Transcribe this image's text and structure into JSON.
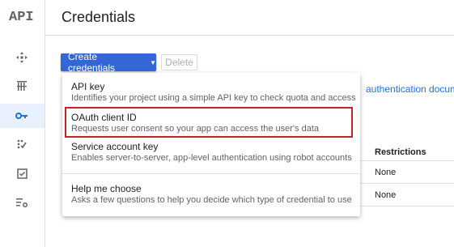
{
  "app": {
    "logo": "API",
    "page_title": "Credentials"
  },
  "toolbar": {
    "create_label": "Create credentials",
    "delete_label": "Delete"
  },
  "background": {
    "link_text": "authentication docume",
    "column_header": "Restrictions",
    "rows": [
      "None",
      "None"
    ]
  },
  "menu": {
    "items": [
      {
        "title": "API key",
        "desc": "Identifies your project using a simple API key to check quota and access"
      },
      {
        "title": "OAuth client ID",
        "desc": "Requests user consent so your app can access the user's data"
      },
      {
        "title": "Service account key",
        "desc": "Enables server-to-server, app-level authentication using robot accounts"
      },
      {
        "title": "Help me choose",
        "desc": "Asks a few questions to help you decide which type of credential to use"
      }
    ],
    "highlighted_item": "OAuth client ID"
  },
  "sidebar": {
    "icons": [
      "dashboard-icon",
      "library-icon",
      "key-icon",
      "domain-verification-icon",
      "consent-icon",
      "settings-icon"
    ],
    "active": "key-icon"
  },
  "colors": {
    "primary": "#3367d6",
    "highlight": "#c5222d",
    "active_bg": "#e8f0fe",
    "active_icon": "#1a73e8"
  }
}
